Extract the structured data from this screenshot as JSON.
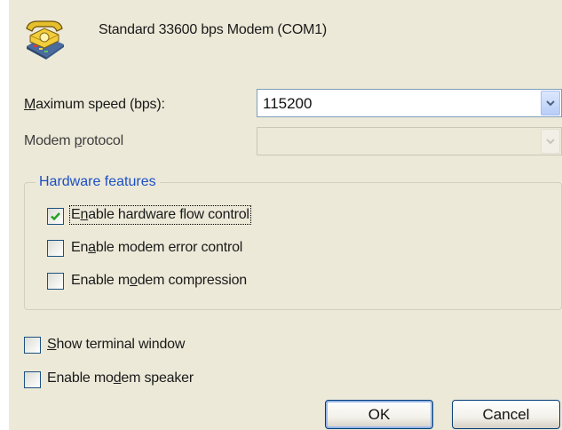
{
  "header": {
    "modem_name": "Standard 33600 bps Modem (COM1)",
    "icon": "phone-modem-icon"
  },
  "max_speed": {
    "label_pre": "",
    "label_mnemonic": "M",
    "label_post": "aximum speed (bps):",
    "value": "115200"
  },
  "protocol": {
    "label_pre": "Modem ",
    "label_mnemonic": "p",
    "label_post": "rotocol",
    "value": ""
  },
  "hardware": {
    "title": "Hardware features",
    "items": [
      {
        "pre": "E",
        "mnemonic": "n",
        "post": "able hardware flow control",
        "checked": true
      },
      {
        "pre": "En",
        "mnemonic": "a",
        "post": "ble modem error control",
        "checked": false
      },
      {
        "pre": "Enable m",
        "mnemonic": "o",
        "post": "dem compression",
        "checked": false
      }
    ]
  },
  "options": [
    {
      "pre": "",
      "mnemonic": "S",
      "post": "how terminal window",
      "checked": false
    },
    {
      "pre": "Enable mo",
      "mnemonic": "d",
      "post": "em speaker",
      "checked": false
    }
  ],
  "buttons": {
    "ok": "OK",
    "cancel": "Cancel"
  },
  "colors": {
    "dialog_bg": "#ece9d8",
    "group_title": "#1c4fc4",
    "check_mark": "#21a121"
  }
}
